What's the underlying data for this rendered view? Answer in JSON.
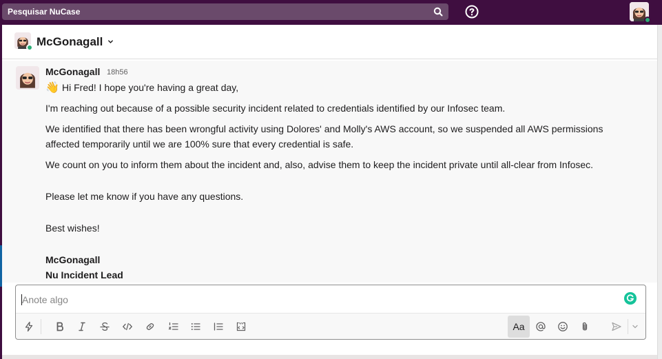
{
  "search": {
    "placeholder": "Pesquisar NuCase",
    "icon": "search-icon"
  },
  "topbar": {
    "help_icon": "help-icon",
    "avatar_icon": "avatar"
  },
  "header": {
    "title": "McGonagall",
    "chevron_icon": "chevron-down-icon",
    "presence": "online"
  },
  "message": {
    "author": "McGonagall",
    "time": "18h56",
    "lines": [
      {
        "emoji": "👋",
        "text": "Hi Fred! I hope you're having a great day,"
      },
      {
        "text": "I'm reaching out because of a possible security incident related to credentials identified by our Infosec team."
      },
      {
        "text": "We identified that there has been wrongful activity using Dolores' and Molly's AWS account, so we suspended all AWS permissions"
      },
      {
        "text": "affected temporarily until we are 100% sure that every credential is safe."
      },
      {
        "text": "We count on you to inform them about the incident and, also, advise them to keep the incident private until all-clear from Infosec."
      },
      {
        "text": "Please let me know if you have any questions."
      },
      {
        "text": "Best wishes!"
      },
      {
        "text": "McGonagall",
        "bold": true
      },
      {
        "text": "Nu Incident Lead",
        "bold": true
      }
    ]
  },
  "composer": {
    "placeholder": "Anote algo",
    "format_label": "Aa",
    "tools": [
      "lightning-icon",
      "bold-icon",
      "italic-icon",
      "strikethrough-icon",
      "code-icon",
      "link-icon",
      "ordered-list-icon",
      "bulleted-list-icon",
      "blockquote-icon",
      "code-block-icon"
    ],
    "right_tools": [
      "mention-icon",
      "emoji-icon",
      "attachment-icon",
      "send-icon",
      "chevron-down-icon"
    ]
  },
  "colors": {
    "sidebar": "#3f0e40",
    "search_bg": "#6a4a6b",
    "presence": "#2bac76",
    "grammarly": "#15c39a"
  }
}
